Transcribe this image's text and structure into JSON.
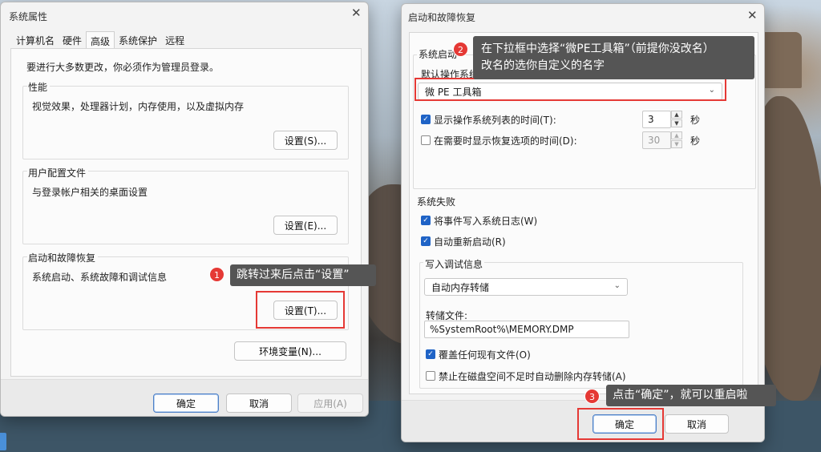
{
  "system_properties": {
    "title": "系统属性",
    "tabs": [
      {
        "label": "计算机名",
        "active": false
      },
      {
        "label": "硬件",
        "active": false
      },
      {
        "label": "高级",
        "active": true
      },
      {
        "label": "系统保护",
        "active": false
      },
      {
        "label": "远程",
        "active": false
      }
    ],
    "admin_note": "要进行大多数更改，你必须作为管理员登录。",
    "performance": {
      "label": "性能",
      "description": "视觉效果，处理器计划，内存使用，以及虚拟内存",
      "button": "设置(S)..."
    },
    "user_profiles": {
      "label": "用户配置文件",
      "description": "与登录帐户相关的桌面设置",
      "button": "设置(E)..."
    },
    "startup_recovery": {
      "label": "启动和故障恢复",
      "description": "系统启动、系统故障和调试信息",
      "button": "设置(T)..."
    },
    "env_button": "环境变量(N)...",
    "footer": {
      "ok": "确定",
      "cancel": "取消",
      "apply": "应用(A)"
    }
  },
  "startup_recovery_dialog": {
    "title": "启动和故障恢复",
    "system_startup": {
      "label": "系统启动",
      "default_os_label": "默认操作系统(S):",
      "default_os_value": "微 PE 工具箱",
      "show_os_list": {
        "label": "显示操作系统列表的时间(T):",
        "checked": true,
        "value": "3",
        "unit": "秒"
      },
      "show_recovery": {
        "label": "在需要时显示恢复选项的时间(D):",
        "checked": false,
        "value": "30",
        "unit": "秒"
      }
    },
    "system_failure": {
      "label": "系统失败",
      "write_event": {
        "label": "将事件写入系统日志(W)",
        "checked": true
      },
      "auto_restart": {
        "label": "自动重新启动(R)",
        "checked": true
      },
      "debug_info": {
        "label": "写入调试信息",
        "dump_type": "自动内存转储",
        "dump_file_label": "转储文件:",
        "dump_file_value": "%SystemRoot%\\MEMORY.DMP",
        "overwrite": {
          "label": "覆盖任何现有文件(O)",
          "checked": true
        },
        "disable_auto_delete": {
          "label": "禁止在磁盘空间不足时自动删除内存转储(A)",
          "checked": false
        }
      }
    },
    "footer": {
      "ok": "确定",
      "cancel": "取消"
    }
  },
  "annotations": [
    {
      "number": "1",
      "text": "跳转过来后点击“设置”"
    },
    {
      "number": "2",
      "line1": "在下拉框中选择“微PE工具箱”（前提你没改名）",
      "line2": "改名的选你自定义的名字"
    },
    {
      "number": "3",
      "text": "点击“确定”，就可以重启啦"
    }
  ],
  "colors": {
    "annotation_red": "#e53935",
    "tooltip_bg": "#555555",
    "checkbox_blue": "#1f63c6"
  },
  "icons": {
    "close": "close-icon",
    "dropdown": "chevron-down-icon",
    "check": "checkmark-icon"
  }
}
